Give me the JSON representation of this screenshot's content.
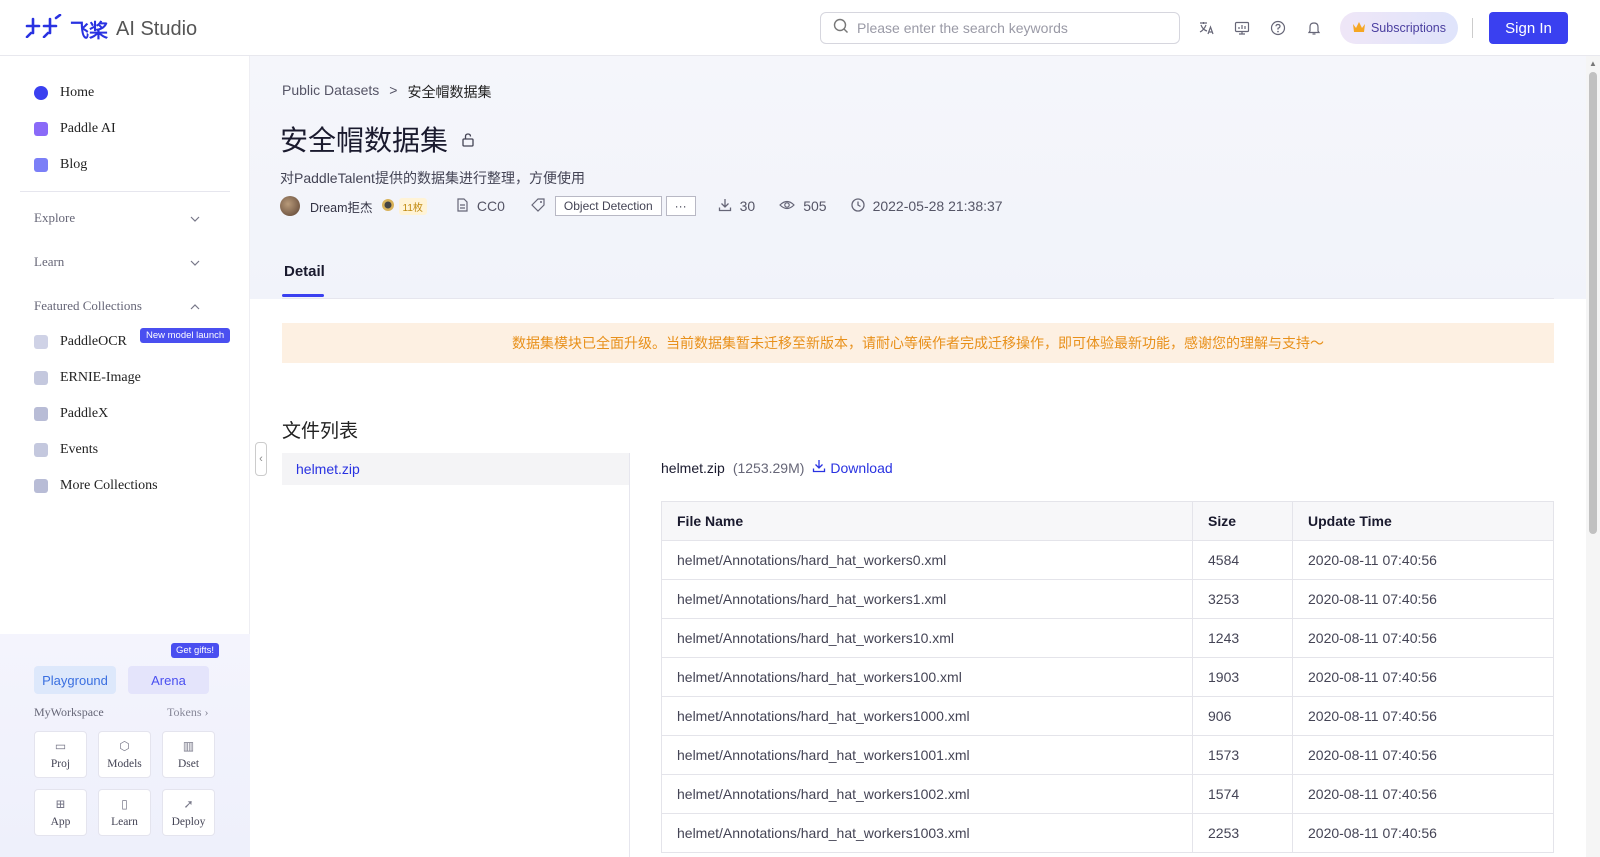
{
  "header": {
    "logo_mark": "†††",
    "logo_cn": "飞桨",
    "logo_text": "AI Studio",
    "search_placeholder": "Please enter the search keywords",
    "subscriptions_label": "Subscriptions",
    "sign_in_label": "Sign In",
    "icons": [
      "translate-icon",
      "monitor-icon",
      "help-icon",
      "bell-icon"
    ]
  },
  "sidebar": {
    "top_items": [
      {
        "label": "Home",
        "icon": "home-icon",
        "color": "#3a40f0"
      },
      {
        "label": "Paddle AI",
        "icon": "paddle-ai-icon",
        "color": "#7a5af8"
      },
      {
        "label": "Blog",
        "icon": "blog-icon",
        "color": "#6b6ff5"
      }
    ],
    "sections": [
      {
        "label": "Explore",
        "expanded": false
      },
      {
        "label": "Learn",
        "expanded": false
      },
      {
        "label": "Featured Collections",
        "expanded": true
      }
    ],
    "collections": [
      {
        "label": "PaddleOCR",
        "icon": "ocr-icon",
        "badge": "New model launch"
      },
      {
        "label": "ERNIE-Image",
        "icon": "image-icon"
      },
      {
        "label": "PaddleX",
        "icon": "paddlex-icon"
      },
      {
        "label": "Events",
        "icon": "flag-icon"
      },
      {
        "label": "More Collections",
        "icon": "collections-icon"
      }
    ],
    "bottom": {
      "playground_label": "Playground",
      "arena_label": "Arena",
      "gift_badge": "Get gifts!",
      "workspace_label": "MyWorkspace",
      "tokens_label": "Tokens",
      "tiles": [
        {
          "label": "Proj",
          "icon": "folder-icon"
        },
        {
          "label": "Models",
          "icon": "cube-icon"
        },
        {
          "label": "Dset",
          "icon": "chart-icon"
        },
        {
          "label": "App",
          "icon": "grid-icon"
        },
        {
          "label": "Learn",
          "icon": "book-icon"
        },
        {
          "label": "Deploy",
          "icon": "rocket-icon"
        }
      ]
    }
  },
  "dataset": {
    "breadcrumb_root": "Public Datasets",
    "breadcrumb_sep": ">",
    "breadcrumb_current": "安全帽数据集",
    "title": "安全帽数据集",
    "description": "对PaddleTalent提供的数据集进行整理，方便使用",
    "author": "Dream拒杰",
    "author_level": "11枚",
    "license": "CC0",
    "tag": "Object Detection",
    "tag_more": "···",
    "downloads": "30",
    "views": "505",
    "created": "2022-05-28 21:38:37",
    "tab_detail": "Detail"
  },
  "notice": "数据集模块已全面升级。当前数据集暂未迁移至新版本，请耐心等候作者完成迁移操作，即可体验最新功能，感谢您的理解与支持～",
  "files": {
    "section_title": "文件列表",
    "list": [
      "helmet.zip"
    ],
    "selected_name": "helmet.zip",
    "selected_size": "(1253.29M)",
    "download_label": "Download",
    "columns": [
      "File Name",
      "Size",
      "Update Time"
    ],
    "rows": [
      [
        "helmet/Annotations/hard_hat_workers0.xml",
        "4584",
        "2020-08-11 07:40:56"
      ],
      [
        "helmet/Annotations/hard_hat_workers1.xml",
        "3253",
        "2020-08-11 07:40:56"
      ],
      [
        "helmet/Annotations/hard_hat_workers10.xml",
        "1243",
        "2020-08-11 07:40:56"
      ],
      [
        "helmet/Annotations/hard_hat_workers100.xml",
        "1903",
        "2020-08-11 07:40:56"
      ],
      [
        "helmet/Annotations/hard_hat_workers1000.xml",
        "906",
        "2020-08-11 07:40:56"
      ],
      [
        "helmet/Annotations/hard_hat_workers1001.xml",
        "1573",
        "2020-08-11 07:40:56"
      ],
      [
        "helmet/Annotations/hard_hat_workers1002.xml",
        "1574",
        "2020-08-11 07:40:56"
      ],
      [
        "helmet/Annotations/hard_hat_workers1003.xml",
        "2253",
        "2020-08-11 07:40:56"
      ]
    ]
  }
}
